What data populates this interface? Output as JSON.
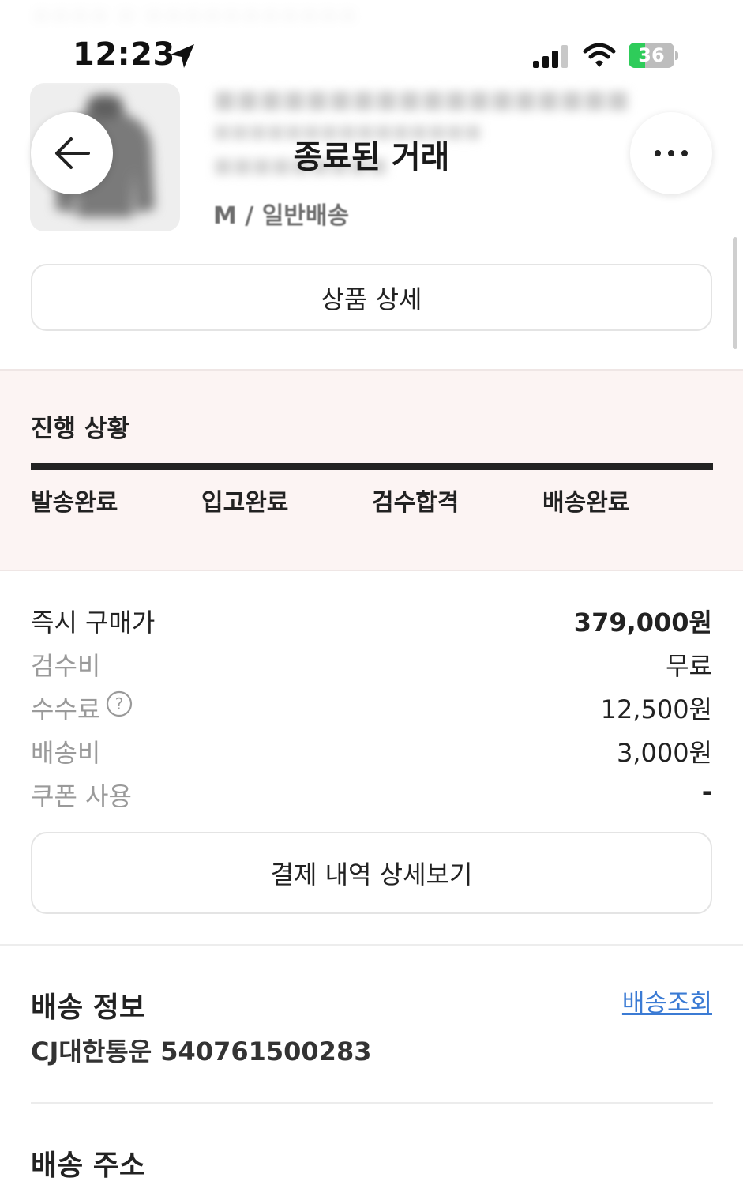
{
  "status_bar": {
    "time": "12:23",
    "battery_level": "36",
    "battery_fraction": 0.36,
    "location_icon": "location-arrow-icon",
    "signal_icon": "cellular-signal-icon",
    "wifi_icon": "wifi-icon",
    "battery_color": "#2ecc5a"
  },
  "nav": {
    "title": "종료된 거래",
    "back_icon": "arrow-left-icon",
    "more_icon": "more-dots-icon"
  },
  "product": {
    "option": "M / 일반배송",
    "detail_button": "상품 상세"
  },
  "progress": {
    "title": "진행 상황",
    "steps": [
      "발송완료",
      "입고완료",
      "검수합격",
      "배송완료"
    ],
    "completed_fraction": 1.0,
    "fill_color": "#222222"
  },
  "payment": {
    "rows": [
      {
        "label": "즉시 구매가",
        "value": "379,000원"
      },
      {
        "label": "검수비",
        "value": "무료"
      },
      {
        "label": "수수료",
        "value": "12,500원"
      },
      {
        "label": "배송비",
        "value": "3,000원"
      },
      {
        "label": "쿠폰 사용",
        "value": "-"
      }
    ],
    "details_button": "결제 내역 상세보기"
  },
  "delivery": {
    "title": "배송 정보",
    "track_link": "배송조회",
    "tracking": "CJ대한통운 540761500283",
    "link_color": "#3b7bd4"
  },
  "address": {
    "title": "배송 주소"
  }
}
